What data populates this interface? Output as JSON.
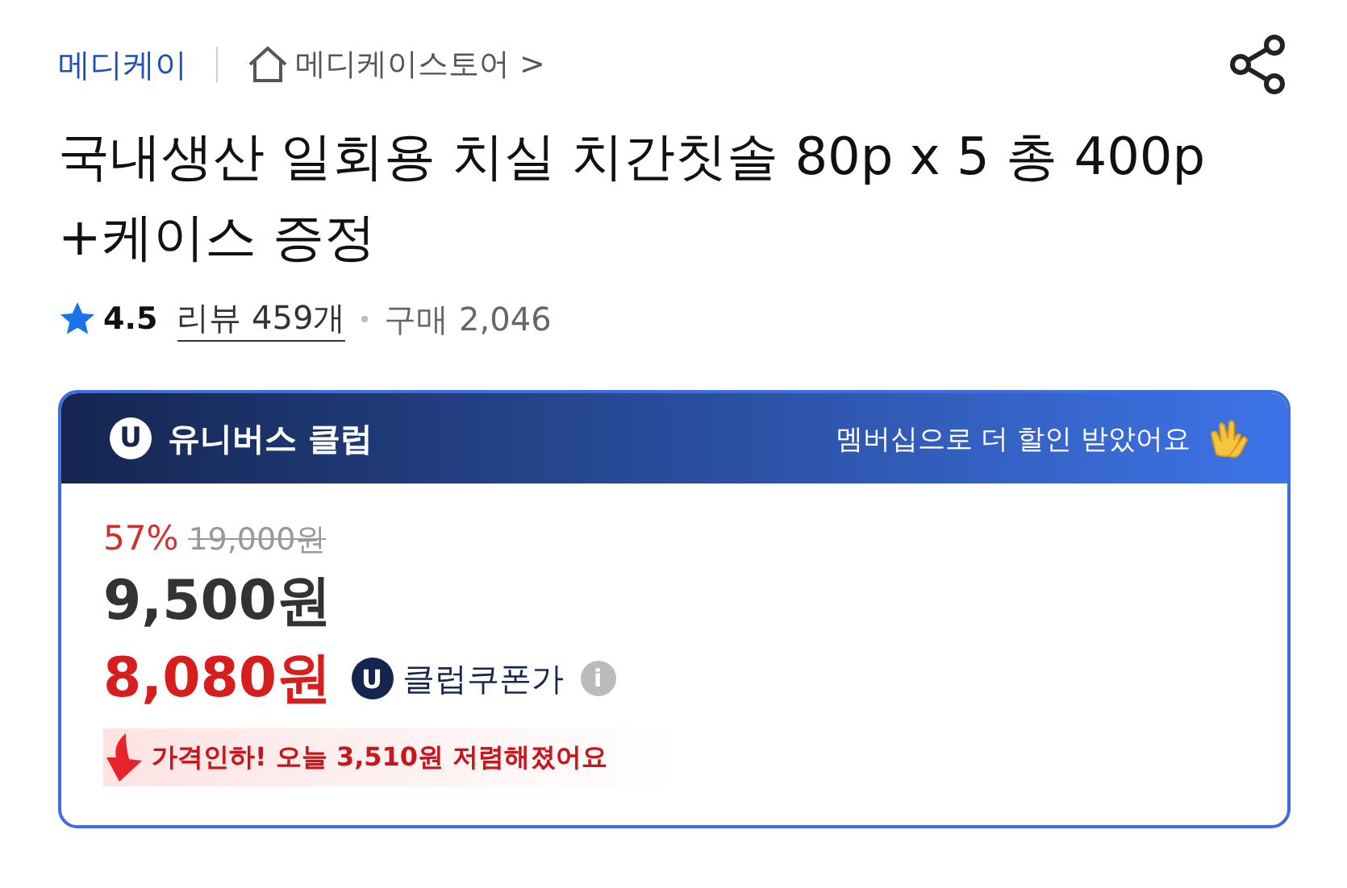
{
  "seller": {
    "brand": "메디케이",
    "store": "메디케이스토어",
    "chevron": ">"
  },
  "title": "국내생산 일회용 치실 치간칫솔 80p x 5 총 400p +케이스 증정",
  "rating": {
    "score": "4.5",
    "reviews": "리뷰 459개",
    "purchases": "구매 2,046"
  },
  "club": {
    "badge": "U",
    "name": "유니버스 클럽",
    "message": "멤버십으로 더 할인 받았어요"
  },
  "price": {
    "discount": "57%",
    "original": "19,000원",
    "sale": "9,500원",
    "coupon_price": "8,080원",
    "coupon_badge": "U",
    "coupon_label": "클럽쿠폰가",
    "info": "i",
    "drop_notice": "가격인하! 오늘 3,510원 저렴해졌어요"
  }
}
